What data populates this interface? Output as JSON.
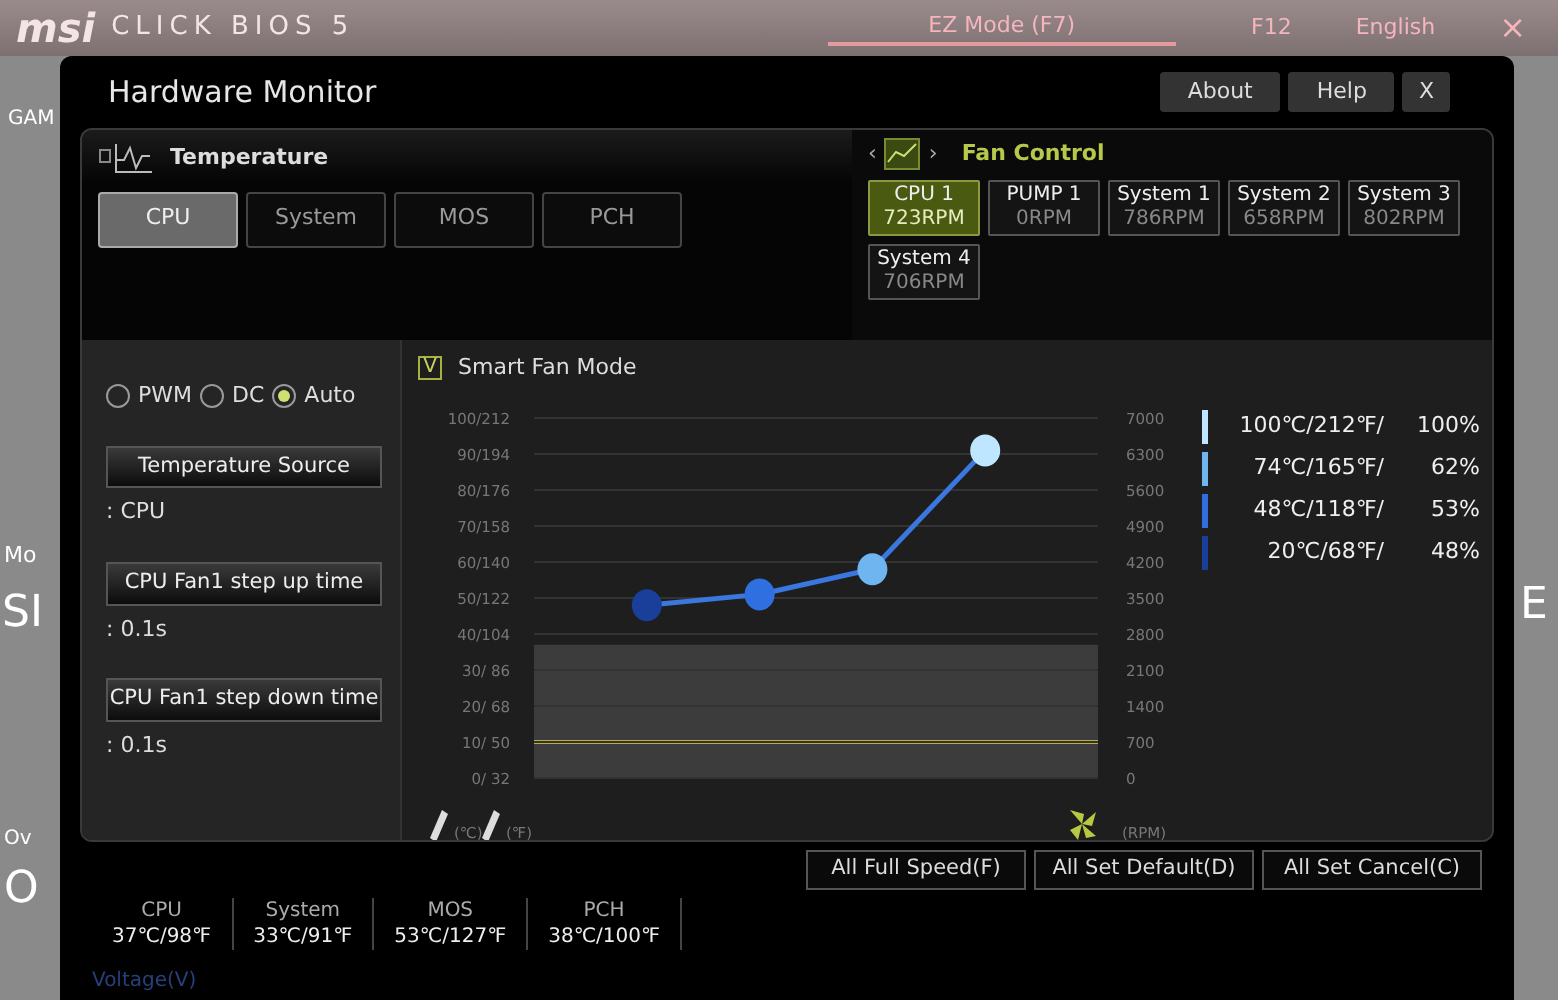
{
  "background": {
    "logo": "msi",
    "product": "CLICK BIOS 5",
    "ez_mode": "EZ Mode (F7)",
    "screenshot_key": "F12",
    "language": "English",
    "close": "×",
    "fragments_left": [
      "GAM",
      "Mo",
      "SI",
      "Ov",
      "O"
    ],
    "fragments_right": [
      "E"
    ]
  },
  "window": {
    "title": "Hardware Monitor",
    "buttons": [
      "About",
      "Help",
      "X"
    ]
  },
  "temperature": {
    "title": "Temperature",
    "tabs": [
      {
        "label": "CPU",
        "selected": true
      },
      {
        "label": "System",
        "selected": false
      },
      {
        "label": "MOS",
        "selected": false
      },
      {
        "label": "PCH",
        "selected": false
      }
    ]
  },
  "fan_control": {
    "title": "Fan Control",
    "prev": "‹",
    "next": "›",
    "fans": [
      {
        "label": "CPU 1",
        "reading": "723RPM",
        "selected": true
      },
      {
        "label": "PUMP 1",
        "reading": "0RPM",
        "selected": false
      },
      {
        "label": "System 1",
        "reading": "786RPM",
        "selected": false
      },
      {
        "label": "System 2",
        "reading": "658RPM",
        "selected": false
      },
      {
        "label": "System 3",
        "reading": "802RPM",
        "selected": false
      },
      {
        "label": "System 4",
        "reading": "706RPM",
        "selected": false
      }
    ]
  },
  "modes": [
    {
      "label": "PWM",
      "selected": false
    },
    {
      "label": "DC",
      "selected": false
    },
    {
      "label": "Auto",
      "selected": true
    }
  ],
  "settings": [
    {
      "label": "Temperature Source",
      "value": ": CPU"
    },
    {
      "label": "CPU Fan1 step up time",
      "value": ": 0.1s"
    },
    {
      "label": "CPU Fan1 step down time",
      "value": ": 0.1s"
    }
  ],
  "smart_fan": {
    "label": "Smart Fan Mode",
    "checked": true,
    "check_mark": "V"
  },
  "temp_ticks": [
    "100/212",
    "90/194",
    "80/176",
    "70/158",
    "60/140",
    "50/122",
    "40/104",
    "30/ 86",
    "20/ 68",
    "10/ 50",
    "0/ 32"
  ],
  "rpm_ticks": [
    "7000",
    "6300",
    "5600",
    "4900",
    "4200",
    "3500",
    "2800",
    "2100",
    "1400",
    "700",
    "0"
  ],
  "unit_celsius": "(℃)",
  "unit_fahrenheit": "(℉)",
  "unit_rpm": "(RPM)",
  "legend": [
    {
      "temp": "100℃/212℉/",
      "percent": "100%",
      "color": "#bfe6ff"
    },
    {
      "temp": "74℃/165℉/",
      "percent": "62%",
      "color": "#6fb6f0"
    },
    {
      "temp": "48℃/118℉/",
      "percent": "53%",
      "color": "#2f6fe0"
    },
    {
      "temp": "20℃/68℉/",
      "percent": "48%",
      "color": "#1a3f9a"
    }
  ],
  "actions": [
    "All Full Speed(F)",
    "All Set Default(D)",
    "All Set Cancel(C)"
  ],
  "readings": [
    {
      "label": "CPU",
      "value": "37℃/98℉"
    },
    {
      "label": "System",
      "value": "33℃/91℉"
    },
    {
      "label": "MOS",
      "value": "53℃/127℉"
    },
    {
      "label": "PCH",
      "value": "38℃/100℉"
    }
  ],
  "voltage_link": "Voltage(V)"
}
